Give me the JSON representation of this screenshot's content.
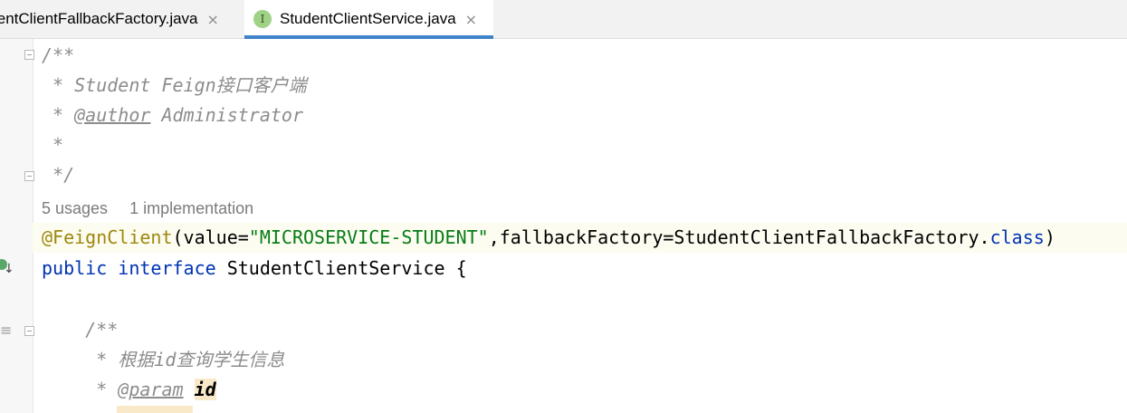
{
  "tabs": [
    {
      "label": "lentClientFallbackFactory.java",
      "active": false,
      "close": "×"
    },
    {
      "label": "StudentClientService.java",
      "active": true,
      "icon": "I",
      "close": "×"
    }
  ],
  "editor": {
    "lines": [
      {
        "text": "/**"
      },
      {
        "text": " * Student Feign接口客户端"
      },
      {
        "prefix": " * ",
        "tag": "@author",
        "rest": " Administrator"
      },
      {
        "text": " *"
      },
      {
        "text": " */"
      }
    ],
    "hints": {
      "usages": "5 usages",
      "impl": "1 implementation"
    },
    "annotation_line": {
      "annotation": "@FeignClient",
      "open": "(value=",
      "string": "\"MICROSERVICE-STUDENT\"",
      "mid": ",fallbackFactory=StudentClientFallbackFactory.",
      "kw_class": "class",
      "close": ")"
    },
    "interface_line": {
      "kw_public": "public",
      "kw_interface": "interface",
      "name": " StudentClientService {"
    },
    "method_doc": {
      "open": "    /**",
      "desc": "     * 根据id查询学生信息",
      "param_prefix": "     * ",
      "param_tag": "@param",
      "param_name": "id"
    }
  },
  "gutter_icons": [
    "implemented-interface-icon",
    "list-icon",
    "fold-marker-icon"
  ],
  "colors": {
    "comment": "#8c8c8c",
    "annotation": "#9e880d",
    "string": "#067d17",
    "keyword": "#0033b3",
    "tab_underline": "#4083c9",
    "interface_icon": "#9fd287"
  }
}
